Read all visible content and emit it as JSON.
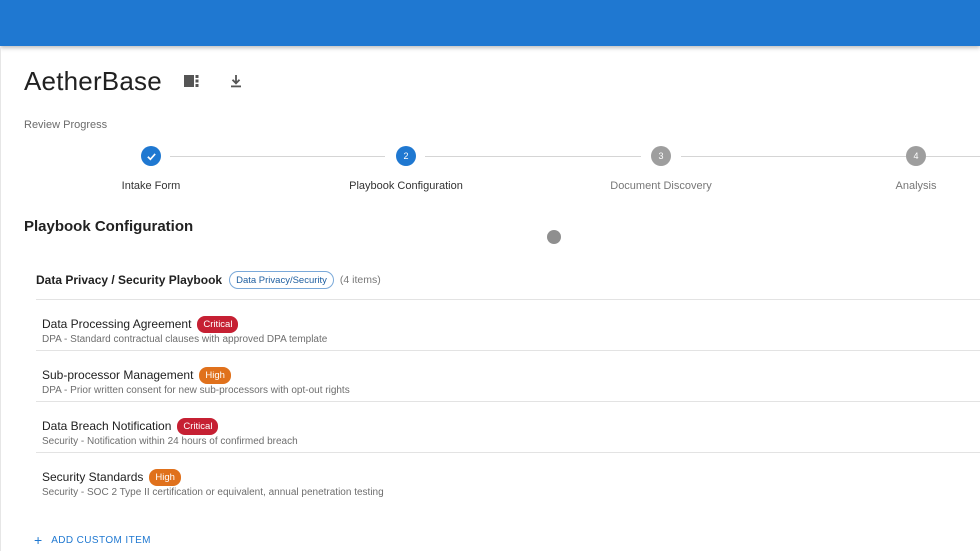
{
  "app": {
    "title": "AetherBase",
    "colors": {
      "topbar": "#1f78d1",
      "accent": "#1f78d1",
      "critical": "#c62033",
      "high": "#e0711c"
    },
    "icons": [
      "view-columns-icon",
      "download-icon"
    ]
  },
  "progress": {
    "label": "Review Progress",
    "current_step": 2,
    "steps": [
      {
        "number": "1",
        "label": "Intake Form",
        "state": "done"
      },
      {
        "number": "2",
        "label": "Playbook Configuration",
        "state": "active"
      },
      {
        "number": "3",
        "label": "Document Discovery",
        "state": "pending"
      },
      {
        "number": "4",
        "label": "Analysis",
        "state": "pending"
      }
    ]
  },
  "section": {
    "title": "Playbook Configuration"
  },
  "playbook": {
    "name": "Data Privacy / Security Playbook",
    "chip": "Data Privacy/Security",
    "count": "(4 items)",
    "items": [
      {
        "title": "Data Processing Agreement",
        "badge": "Critical",
        "severity": "critical",
        "description": "DPA - Standard contractual clauses with approved DPA template"
      },
      {
        "title": "Sub-processor Management",
        "badge": "High",
        "severity": "high",
        "description": "DPA - Prior written consent for new sub-processors with opt-out rights"
      },
      {
        "title": "Data Breach Notification",
        "badge": "Critical",
        "severity": "critical",
        "description": "Security - Notification within 24 hours of confirmed breach"
      },
      {
        "title": "Security Standards",
        "badge": "High",
        "severity": "high",
        "description": "Security - SOC 2 Type II certification or equivalent, annual penetration testing"
      }
    ],
    "add_label": "ADD CUSTOM ITEM"
  }
}
